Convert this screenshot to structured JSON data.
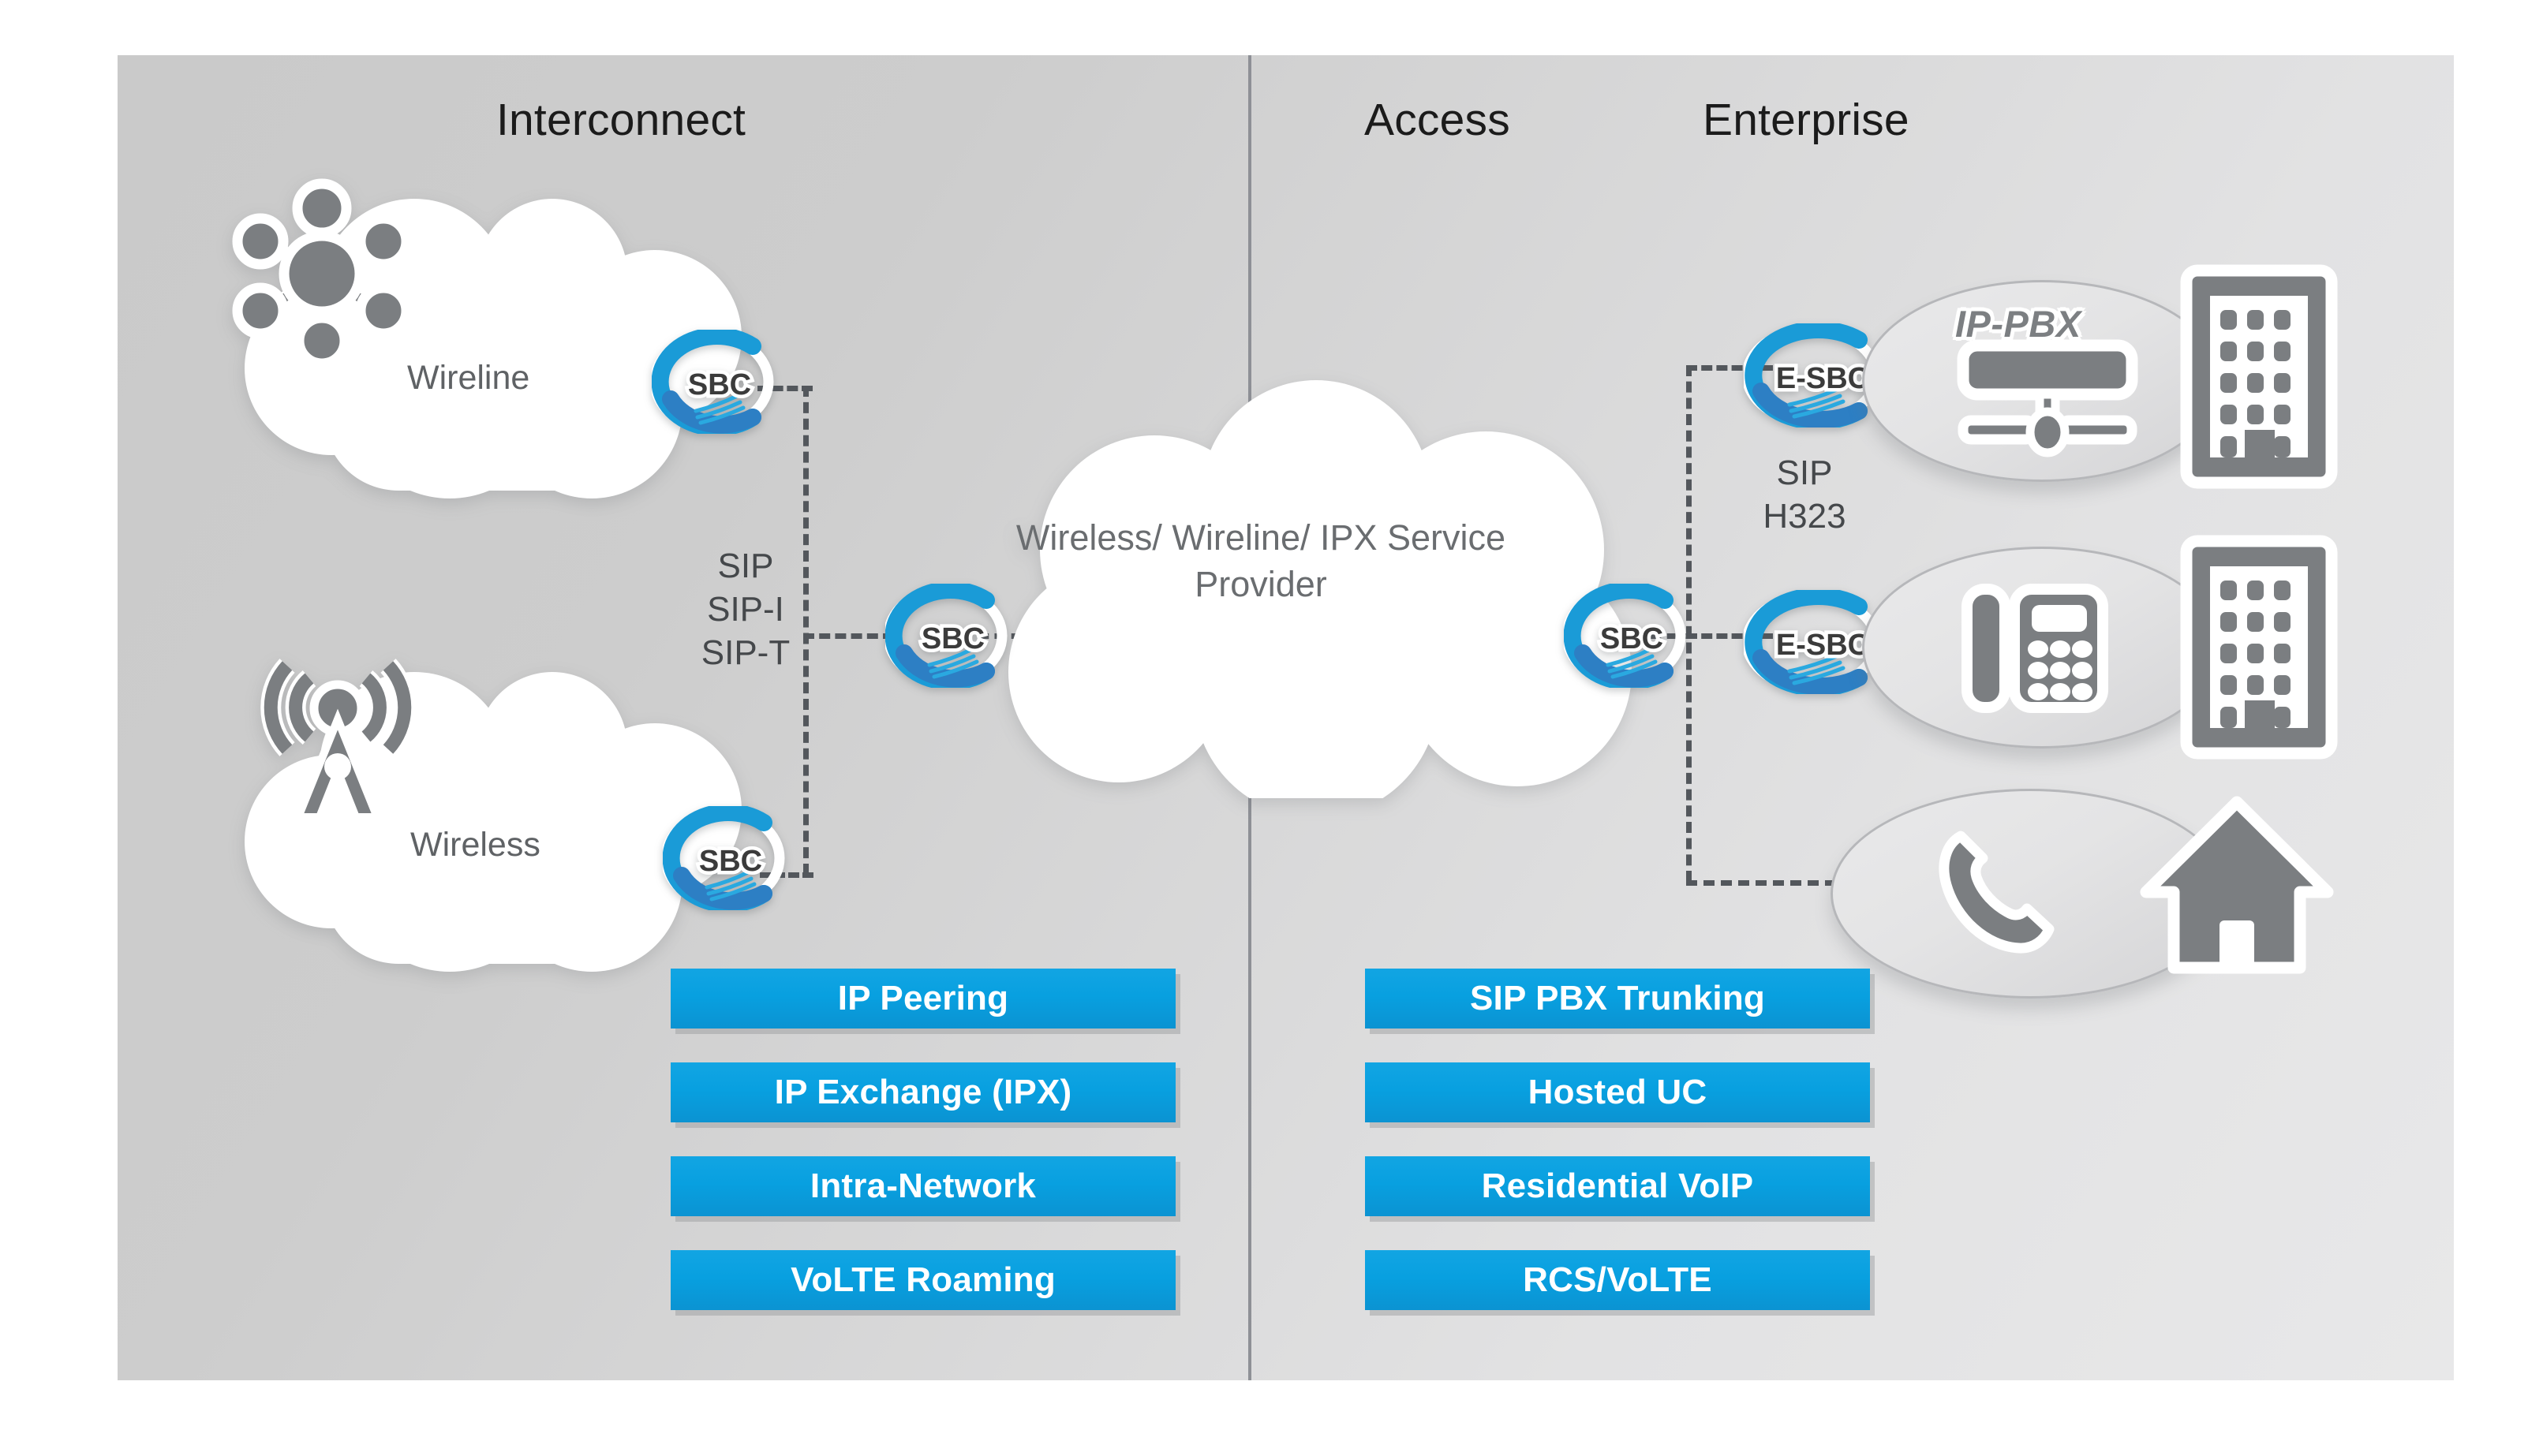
{
  "columns": [
    {
      "label": "Interconnect"
    },
    {
      "label": "Access"
    },
    {
      "label": "Enterprise"
    }
  ],
  "clouds": {
    "wireline": {
      "label": "Wireline",
      "icon": "network-hub-icon"
    },
    "wireless": {
      "label": "Wireless",
      "icon": "broadcast-tower-icon"
    },
    "core": {
      "text": "Wireless/\nWireline/\nIPX\nService Provider"
    }
  },
  "protocols": {
    "interconnect": "SIP\nSIP-I\nSIP-T",
    "enterprise": "SIP\nH323"
  },
  "sbc_nodes": [
    {
      "id": "sbc-wireline",
      "label": "SBC"
    },
    {
      "id": "sbc-wireless",
      "label": "SBC"
    },
    {
      "id": "sbc-core-left",
      "label": "SBC"
    },
    {
      "id": "sbc-core-right",
      "label": "SBC"
    },
    {
      "id": "esbc-top",
      "label": "E-SBC"
    },
    {
      "id": "esbc-mid",
      "label": "E-SBC"
    }
  ],
  "enterprise_groups": [
    {
      "id": "ippbx",
      "caption": "IP-PBX",
      "icon": "server-rack-icon",
      "companion": "office-building-icon"
    },
    {
      "id": "desk-phone",
      "caption": "",
      "icon": "desk-phone-icon",
      "companion": "office-building-icon"
    },
    {
      "id": "residential",
      "caption": "",
      "icon": "phone-handset-icon",
      "companion": "house-icon"
    }
  ],
  "service_bars": {
    "interconnect": [
      "IP Peering",
      "IP Exchange (IPX)",
      "Intra-Network",
      "VoLTE Roaming"
    ],
    "access": [
      "SIP PBX Trunking",
      "Hosted UC",
      "Residential VoIP",
      "RCS/VoLTE"
    ]
  },
  "colors": {
    "bar_blue": "#0ba0e0",
    "sbc_blue": "#1a9bd7",
    "panel_gray": "#d2d2d3",
    "icon_gray": "#7b7e81",
    "text_dark": "#1b1b1b",
    "dash_gray": "#53575c"
  }
}
